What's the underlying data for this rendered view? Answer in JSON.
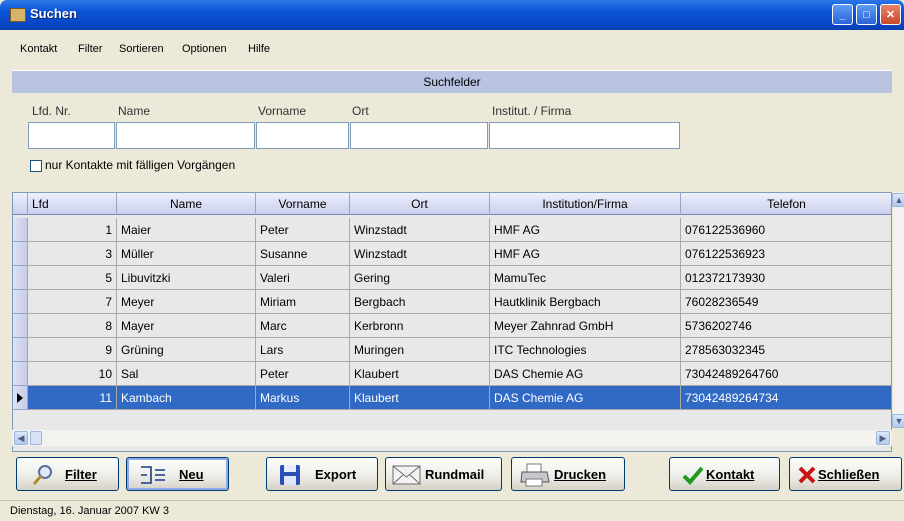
{
  "window": {
    "title": "Suchen"
  },
  "menu": [
    "Kontakt",
    "Filter",
    "Sortieren",
    "Optionen",
    "Hilfe"
  ],
  "search": {
    "header": "Suchfelder",
    "fields": [
      {
        "label": "Lfd. Nr.",
        "value": ""
      },
      {
        "label": "Name",
        "value": ""
      },
      {
        "label": "Vorname",
        "value": ""
      },
      {
        "label": "Ort",
        "value": ""
      },
      {
        "label": "Institut. / Firma",
        "value": ""
      }
    ],
    "checkbox_label": "nur Kontakte mit fälligen Vorgängen",
    "checkbox_checked": false
  },
  "grid": {
    "columns": [
      "Lfd",
      "Name",
      "Vorname",
      "Ort",
      "Institution/Firma",
      "Telefon"
    ],
    "rows": [
      {
        "lfd": "1",
        "name": "Maier",
        "vorname": "Peter",
        "ort": "Winzstadt",
        "firma": "HMF AG",
        "telefon": "076122536960"
      },
      {
        "lfd": "3",
        "name": "Müller",
        "vorname": "Susanne",
        "ort": "Winzstadt",
        "firma": "HMF AG",
        "telefon": "076122536923"
      },
      {
        "lfd": "5",
        "name": "Libuvitzki",
        "vorname": "Valeri",
        "ort": "Gering",
        "firma": "MamuTec",
        "telefon": "012372173930"
      },
      {
        "lfd": "7",
        "name": "Meyer",
        "vorname": "Miriam",
        "ort": "Bergbach",
        "firma": "Hautklinik Bergbach",
        "telefon": "76028236549"
      },
      {
        "lfd": "8",
        "name": "Mayer",
        "vorname": "Marc",
        "ort": "Kerbronn",
        "firma": "Meyer Zahnrad GmbH",
        "telefon": "5736202746"
      },
      {
        "lfd": "9",
        "name": "Grüning",
        "vorname": "Lars",
        "ort": "Muringen",
        "firma": "ITC Technologies",
        "telefon": "278563032345"
      },
      {
        "lfd": "10",
        "name": "Sal",
        "vorname": "Peter",
        "ort": "Klaubert",
        "firma": "DAS Chemie AG",
        "telefon": "73042489264760"
      },
      {
        "lfd": "11",
        "name": "Kambach",
        "vorname": "Markus",
        "ort": "Klaubert",
        "firma": "DAS Chemie AG",
        "telefon": "73042489264734"
      }
    ],
    "selected_lfd": "11"
  },
  "buttons": {
    "filter": "Filter",
    "neu": "Neu",
    "export": "Export",
    "rundmail": "Rundmail",
    "drucken": "Drucken",
    "kontakt": "Kontakt",
    "schliessen": "Schließen"
  },
  "status": "Dienstag, 16. Januar 2007  KW 3",
  "colors": {
    "titlebar": "#0a52d6",
    "selection": "#316ac5",
    "section_header": "#b9c4e2"
  }
}
